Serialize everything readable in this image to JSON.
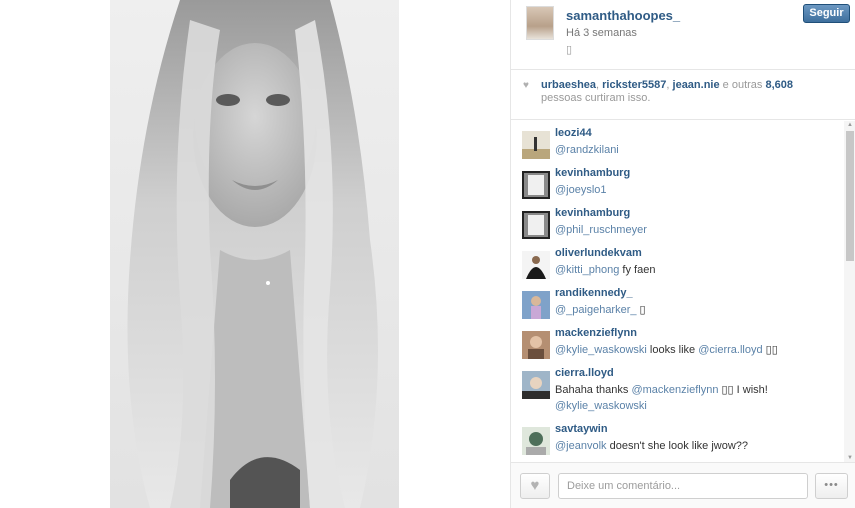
{
  "post": {
    "username": "samanthahoopes_",
    "time_ago": "Há 3 semanas",
    "caption_glyph": "▯",
    "follow_label": "Seguir"
  },
  "likes": {
    "users": [
      "urbaeshea",
      "rickster5587",
      "jeaan.nie"
    ],
    "others_prefix": "e outras",
    "count": "8,608",
    "suffix": "pessoas curtiram isso."
  },
  "comments": [
    {
      "user": "leozi44",
      "text": "@randzkilani"
    },
    {
      "user": "kevinhamburg",
      "text": "@joeyslo1"
    },
    {
      "user": "kevinhamburg",
      "text": "@phil_ruschmeyer"
    },
    {
      "user": "oliverlundekvam",
      "mention": "@kitti_phong",
      "rest": " fy faen"
    },
    {
      "user": "randikennedy_",
      "mention": "@_paigeharker_",
      "rest": " ▯"
    },
    {
      "user": "mackenzieflynn",
      "mention": "@kylie_waskowski",
      "mid": " looks like ",
      "mention2": "@cierra.lloyd",
      "rest": " ▯▯"
    },
    {
      "user": "cierra.lloyd",
      "pre": "Bahaha thanks ",
      "mention": "@mackenzieflynn",
      "rest": " ▯▯ I wish!",
      "line2": "@kylie_waskowski"
    },
    {
      "user": "savtaywin",
      "mention": "@jeanvolk",
      "rest": " doesn't she look like jwow??"
    }
  ],
  "input": {
    "placeholder": "Deixe um comentário..."
  },
  "icons": {
    "like": "heart-icon",
    "more": "more-options-icon"
  },
  "colors": {
    "link": "#2f5b85",
    "follow_button": "#3e6f9d"
  }
}
